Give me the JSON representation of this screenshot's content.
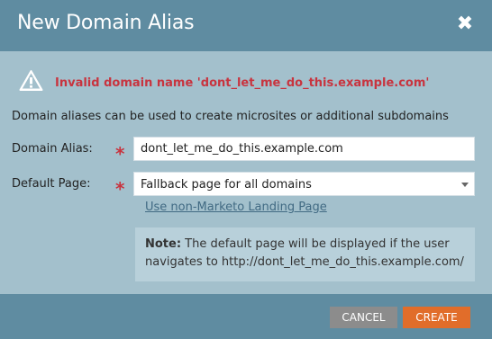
{
  "dialog": {
    "title": "New Domain Alias",
    "close_glyph": "✖"
  },
  "error": {
    "icon": "warning-icon",
    "message": "Invalid domain name 'dont_let_me_do_this.example.com'"
  },
  "description": "Domain aliases can be used to create microsites or additional subdomains",
  "fields": {
    "alias": {
      "label": "Domain Alias:",
      "required_marker": "*",
      "value": "dont_let_me_do_this.example.com"
    },
    "default_page": {
      "label": "Default Page:",
      "required_marker": "*",
      "selected": "Fallback page for all domains"
    }
  },
  "link": "Use non-Marketo Landing Page",
  "note": {
    "prefix": "Note:",
    "text": " The default page will be displayed if the user navigates to http://dont_let_me_do_this.example.com/"
  },
  "buttons": {
    "cancel": "CANCEL",
    "create": "CREATE"
  },
  "colors": {
    "header": "#5f8ca1",
    "body": "#a3c0cc",
    "error": "#c8343f",
    "create": "#e16d2a",
    "cancel": "#8c8c8c"
  }
}
